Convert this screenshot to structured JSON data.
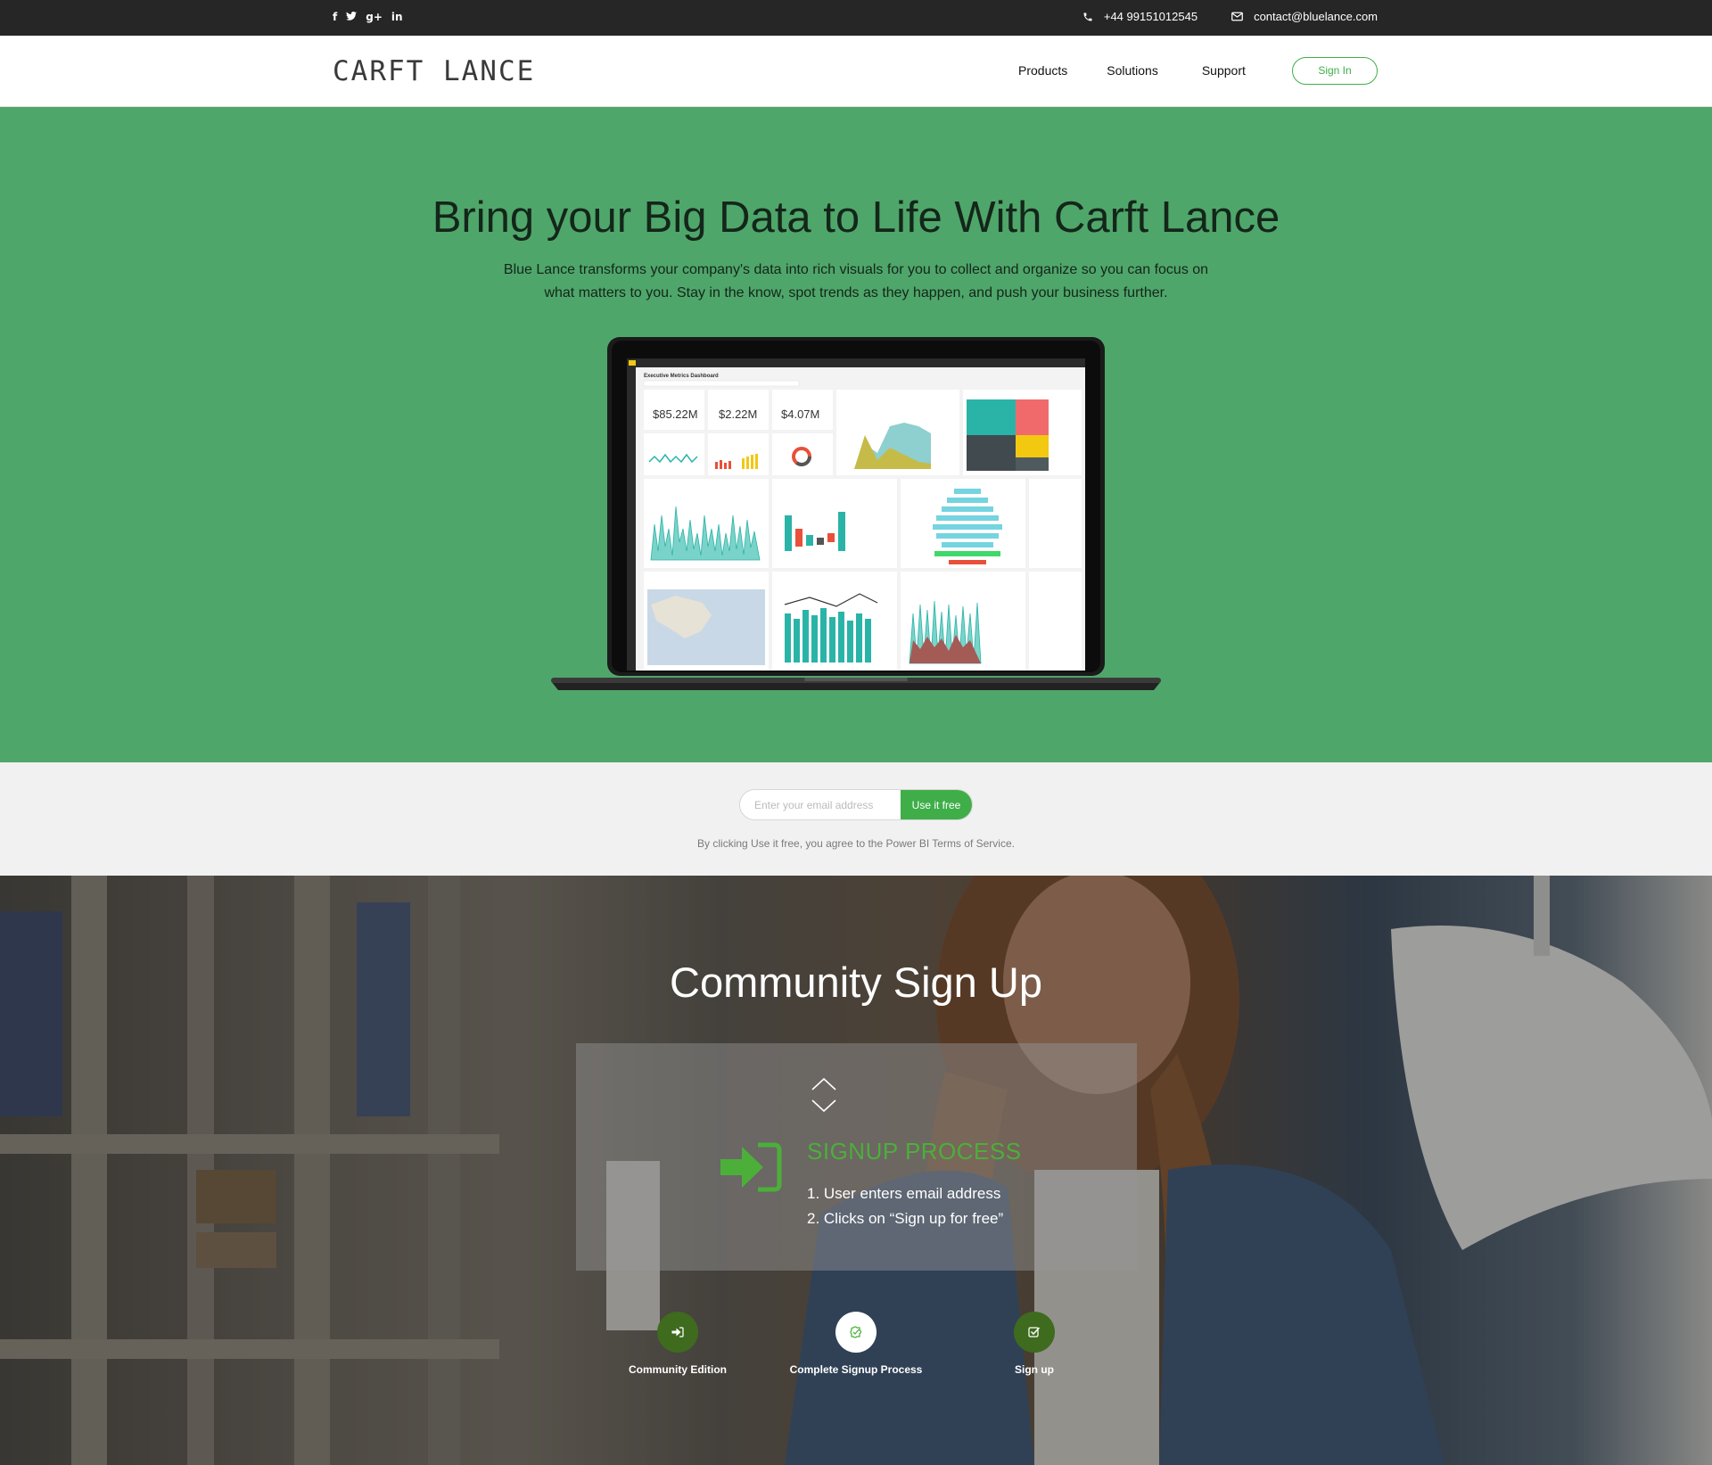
{
  "topbar": {
    "social": [
      "f",
      "t",
      "g+",
      "in"
    ],
    "phone": "+44 99151012545",
    "email": "contact@bluelance.com"
  },
  "nav": {
    "logo": "CARFT LANCE",
    "items": [
      "Products",
      "Solutions",
      "Support"
    ],
    "signin": "Sign In"
  },
  "hero": {
    "title": "Bring your Big Data to Life With Carft Lance",
    "description": "Blue Lance transforms your company's data into rich visuals for you to collect and organize so you can focus on what matters to you. Stay in the know, spot trends as they happen, and push your business further.",
    "dashboard": {
      "title": "Executive Metrics Dashboard",
      "kpis": [
        "$85.22M",
        "$2.22M",
        "$4.07M"
      ]
    }
  },
  "signup_band": {
    "placeholder": "Enter your email address",
    "button": "Use it free",
    "terms": "By clicking Use it free, you agree to the Power BI Terms of Service."
  },
  "community": {
    "title": "Community Sign Up",
    "process_title": "SIGNUP PROCESS",
    "steps": [
      "1.  User enters email address",
      "2. Clicks on “Sign up for free”"
    ],
    "stepper": [
      {
        "label": "Community Edition",
        "icon": "sign-in-icon"
      },
      {
        "label": "Complete Signup Process",
        "icon": "puzzle-icon"
      },
      {
        "label": "Sign up",
        "icon": "check-square-icon"
      }
    ]
  },
  "colors": {
    "accent": "#3fae49",
    "hero_bg": "#4fa66a",
    "topbar_bg": "#262626"
  }
}
